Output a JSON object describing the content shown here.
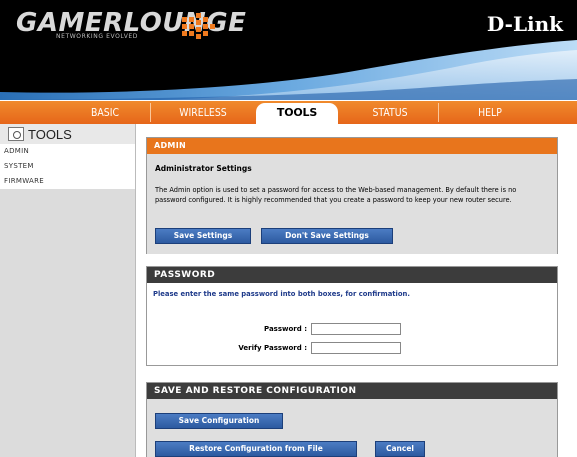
{
  "header": {
    "logo_text": "GAMERLOUNGE",
    "logo_tagline": "NETWORKING EVOLVED",
    "brand": "D-Link"
  },
  "nav": {
    "tabs": [
      {
        "label": "BASIC",
        "active": false
      },
      {
        "label": "WIRELESS",
        "active": false
      },
      {
        "label": "TOOLS",
        "active": true
      },
      {
        "label": "STATUS",
        "active": false
      },
      {
        "label": "HELP",
        "active": false
      }
    ]
  },
  "sidebar": {
    "title": "TOOLS",
    "items": [
      {
        "label": "ADMIN"
      },
      {
        "label": "SYSTEM"
      },
      {
        "label": "FIRMWARE"
      }
    ]
  },
  "admin": {
    "header": "ADMIN",
    "title": "Administrator Settings",
    "description": "The Admin option is used to set a password for access to the Web-based management. By default there is no password configured. It is highly recommended that you create a password to keep your new router secure.",
    "save_label": "Save Settings",
    "dont_save_label": "Don't Save Settings"
  },
  "password": {
    "header": "PASSWORD",
    "description": "Please enter the same password into both boxes, for confirmation.",
    "password_label": "Password :",
    "verify_label": "Verify Password :",
    "password_value": "",
    "verify_value": ""
  },
  "save_restore": {
    "header": "SAVE AND RESTORE CONFIGURATION",
    "save_config_label": "Save Configuration",
    "restore_label": "Restore Configuration from File",
    "cancel_label": "Cancel"
  },
  "colors": {
    "nav_orange": "#e8751c",
    "button_blue": "#2d5aa0",
    "dark_header": "#3c3c3c"
  }
}
